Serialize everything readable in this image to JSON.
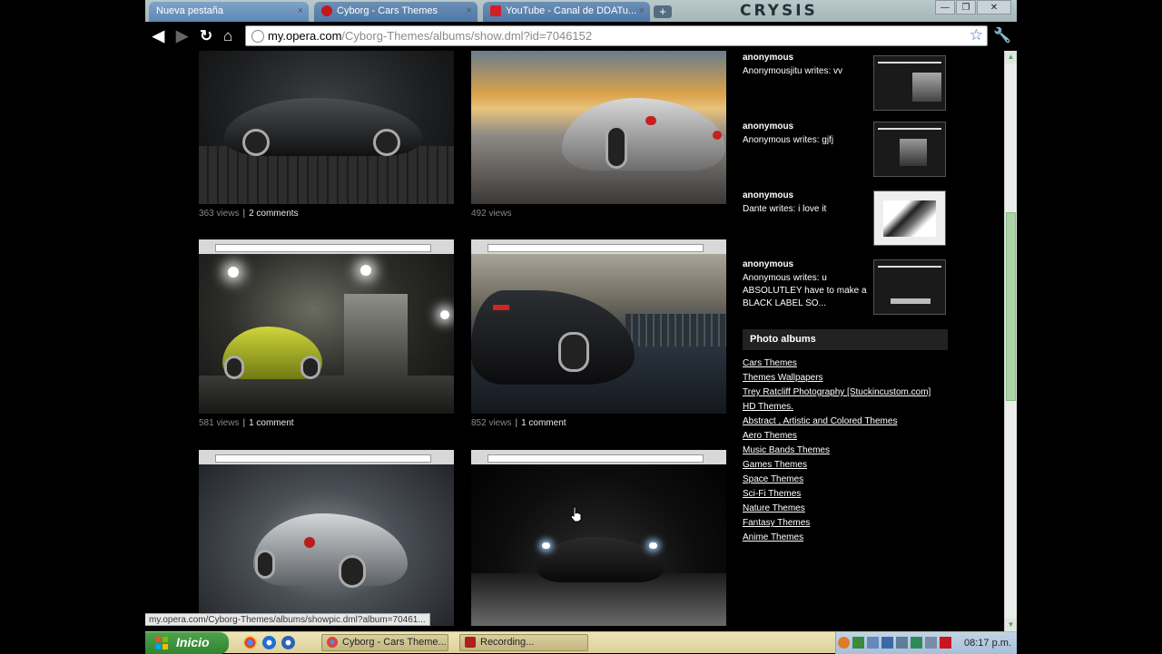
{
  "window": {
    "brand": "CRYSIS",
    "min_label": "—",
    "restore_label": "❐",
    "close_label": "✕"
  },
  "tabs": [
    {
      "label": "Nueva pestaña",
      "close": "×"
    },
    {
      "label": "Cyborg - Cars Themes",
      "close": "×"
    },
    {
      "label": "YouTube - Canal de DDATu...",
      "close": "×"
    }
  ],
  "toolbar": {
    "back": "◀",
    "forward": "▶",
    "reload": "↻",
    "home": "⌂",
    "url_host": "my.opera.com",
    "url_path": "/Cyborg-Themes/albums/show.dml?id=7046152",
    "star": "☆",
    "wrench": "🔧"
  },
  "photos": [
    {
      "views": "363 views",
      "comments": "2 comments"
    },
    {
      "views": "492 views",
      "comments": ""
    },
    {
      "views": "581 views",
      "comments": "1 comment"
    },
    {
      "views": "852 views",
      "comments": "1 comment"
    },
    {
      "views": "",
      "comments": ""
    },
    {
      "views": "",
      "comments": ""
    }
  ],
  "comments": [
    {
      "name": "anonymous",
      "text": "Anonymousjitu writes: vv"
    },
    {
      "name": "anonymous",
      "text": "Anonymous writes: gjfj"
    },
    {
      "name": "anonymous",
      "text": "Dante writes: i love it"
    },
    {
      "name": "anonymous",
      "text": "Anonymous writes: u ABSOLUTLEY have to make a BLACK LABEL SO..."
    }
  ],
  "albums_header": "Photo albums",
  "albums": [
    "Cars Themes",
    "Themes Wallpapers",
    "Trey Ratcliff Photography [Stuckincustom.com]",
    "HD Themes.",
    "Abstract , Artistic and Colored Themes",
    "Aero Themes",
    "Music Bands Themes",
    "Games Themes",
    "Space Themes",
    "Sci-Fi Themes",
    "Nature Themes",
    "Fantasy Themes",
    "Anime Themes"
  ],
  "status_url": "my.opera.com/Cyborg-Themes/albums/showpic.dml?album=70461...",
  "taskbar": {
    "start": "Inicio",
    "buttons": [
      "Cyborg - Cars Theme...",
      "Recording..."
    ],
    "clock": "08:17 p.m."
  },
  "colors": {
    "page_bg": "#000000",
    "link": "#ffffff",
    "xp_green": "#2f862f",
    "xp_taskbar": "#ede5ba"
  }
}
